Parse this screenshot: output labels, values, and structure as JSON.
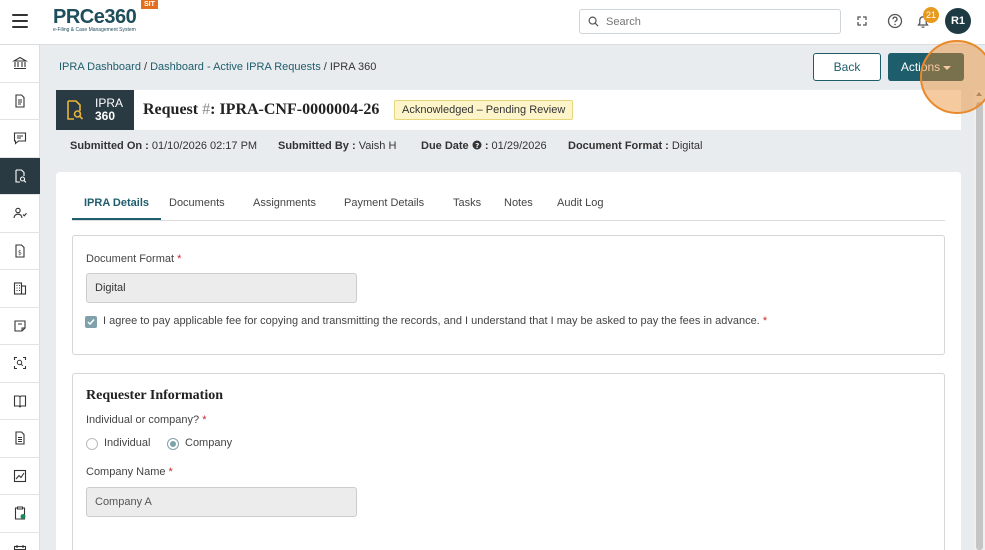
{
  "header": {
    "logo_text": "PRCe360",
    "logo_subtitle": "e-Filing & Case Management System",
    "env_badge": "SIT",
    "search_placeholder": "Search",
    "notification_count": "21",
    "avatar_initials": "R1"
  },
  "sidebar": {
    "items": [
      {
        "icon": "bank-icon",
        "active": false
      },
      {
        "icon": "document-icon",
        "active": false
      },
      {
        "icon": "chat-icon",
        "active": false
      },
      {
        "icon": "document-search-icon",
        "active": true
      },
      {
        "icon": "users-icon",
        "active": false
      },
      {
        "icon": "invoice-icon",
        "active": false
      },
      {
        "icon": "building-icon",
        "active": false
      },
      {
        "icon": "note-icon",
        "active": false
      },
      {
        "icon": "scan-icon",
        "active": false
      },
      {
        "icon": "book-icon",
        "active": false
      },
      {
        "icon": "file-text-icon",
        "active": false
      },
      {
        "icon": "chart-icon",
        "active": false
      },
      {
        "icon": "clipboard-check-icon",
        "active": false
      },
      {
        "icon": "calendar-icon",
        "active": false
      }
    ]
  },
  "breadcrumb": {
    "items": [
      "IPRA Dashboard",
      "Dashboard - Active IPRA Requests"
    ],
    "current": "IPRA 360",
    "separator": " / "
  },
  "actions": {
    "back_label": "Back",
    "actions_label": "Actions"
  },
  "request": {
    "logo_line1": "IPRA",
    "logo_line2": "360",
    "title_prefix": "Request ",
    "title_hash": "#",
    "title_suffix": ": IPRA-CNF-0000004-26",
    "status": "Acknowledged – Pending Review"
  },
  "meta": {
    "submitted_on_label": "Submitted On :",
    "submitted_on_value": "01/10/2026 02:17 PM",
    "submitted_by_label": "Submitted By :",
    "submitted_by_value": "Vaish H",
    "due_date_label": "Due Date",
    "due_date_sep": ":",
    "due_date_value": "01/29/2026",
    "doc_format_label": "Document Format :",
    "doc_format_value": "Digital"
  },
  "tabs": [
    {
      "label": "IPRA Details",
      "active": true
    },
    {
      "label": "Documents",
      "active": false
    },
    {
      "label": "Assignments",
      "active": false
    },
    {
      "label": "Payment Details",
      "active": false
    },
    {
      "label": "Tasks",
      "active": false
    },
    {
      "label": "Notes",
      "active": false
    },
    {
      "label": "Audit Log",
      "active": false
    }
  ],
  "document_section": {
    "format_label": "Document Format",
    "format_value": "Digital",
    "agree_checked": true,
    "agree_text": "I agree to pay applicable fee for copying and transmitting the records, and I understand that I may be asked to pay the fees in advance."
  },
  "requester_section": {
    "title": "Requester Information",
    "type_label": "Individual or company?",
    "option_individual": "Individual",
    "option_company": "Company",
    "selected": "Company",
    "company_name_label": "Company Name",
    "company_name_value": "Company A",
    "required_mark": "*"
  },
  "colors": {
    "primary": "#1e5d6c",
    "dark": "#2a3a42",
    "status_bg": "#fdf5c9",
    "highlight": "#e8892b",
    "badge": "#e89a1f"
  }
}
